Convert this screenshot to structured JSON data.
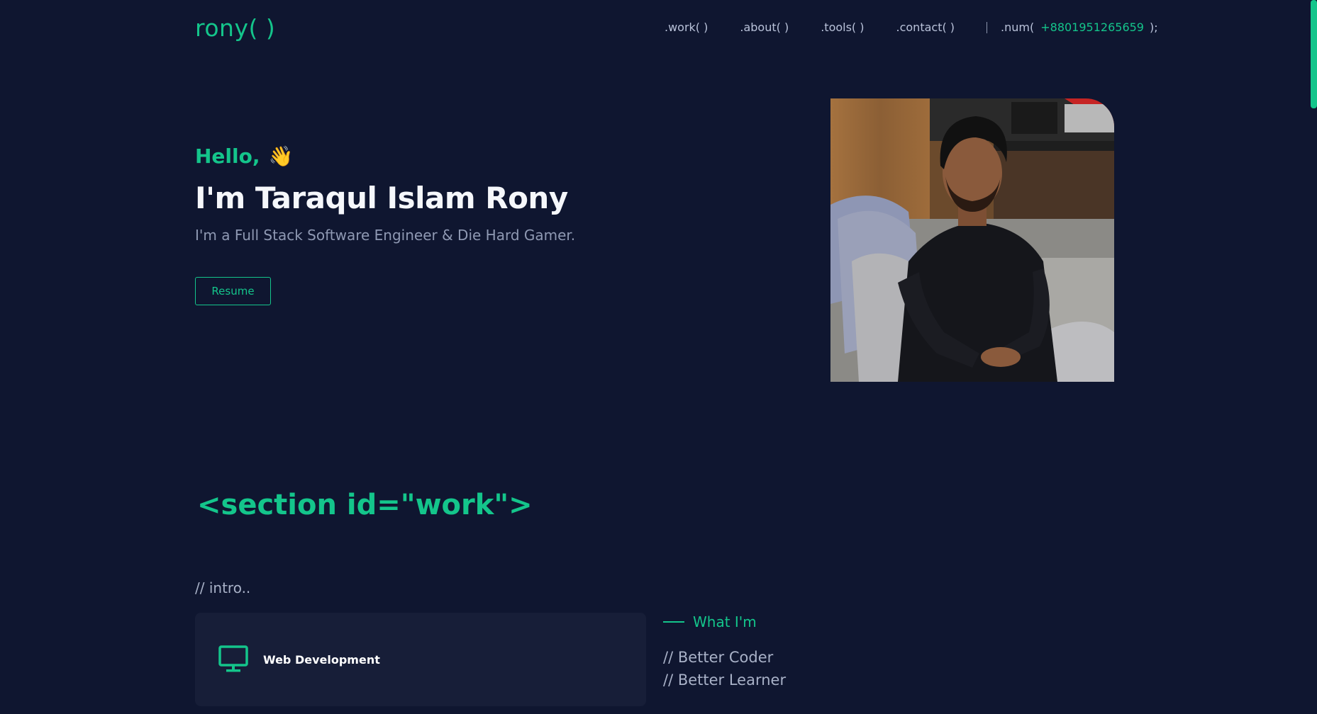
{
  "brand": {
    "logo": "rony( )"
  },
  "nav": {
    "items": [
      ".work( )",
      ".about( )",
      ".tools( )",
      ".contact( )"
    ],
    "num_label": ".num(",
    "num_value": "+8801951265659",
    "num_end": ");"
  },
  "hero": {
    "greeting": "Hello,",
    "wave": "👋",
    "name": "I'm Taraqul Islam Rony",
    "tagline": "I'm a Full Stack Software Engineer & Die Hard Gamer.",
    "resume_label": "Resume"
  },
  "work": {
    "section_tag": "<section id=\"work\">",
    "intro": "// intro..",
    "card_title": "Web Development",
    "what_im": "What I'm",
    "traits": [
      "// Better Coder",
      "// Better Learner"
    ]
  },
  "colors": {
    "background": "#0f1630",
    "accent": "#14c58b",
    "card": "#171e38"
  }
}
